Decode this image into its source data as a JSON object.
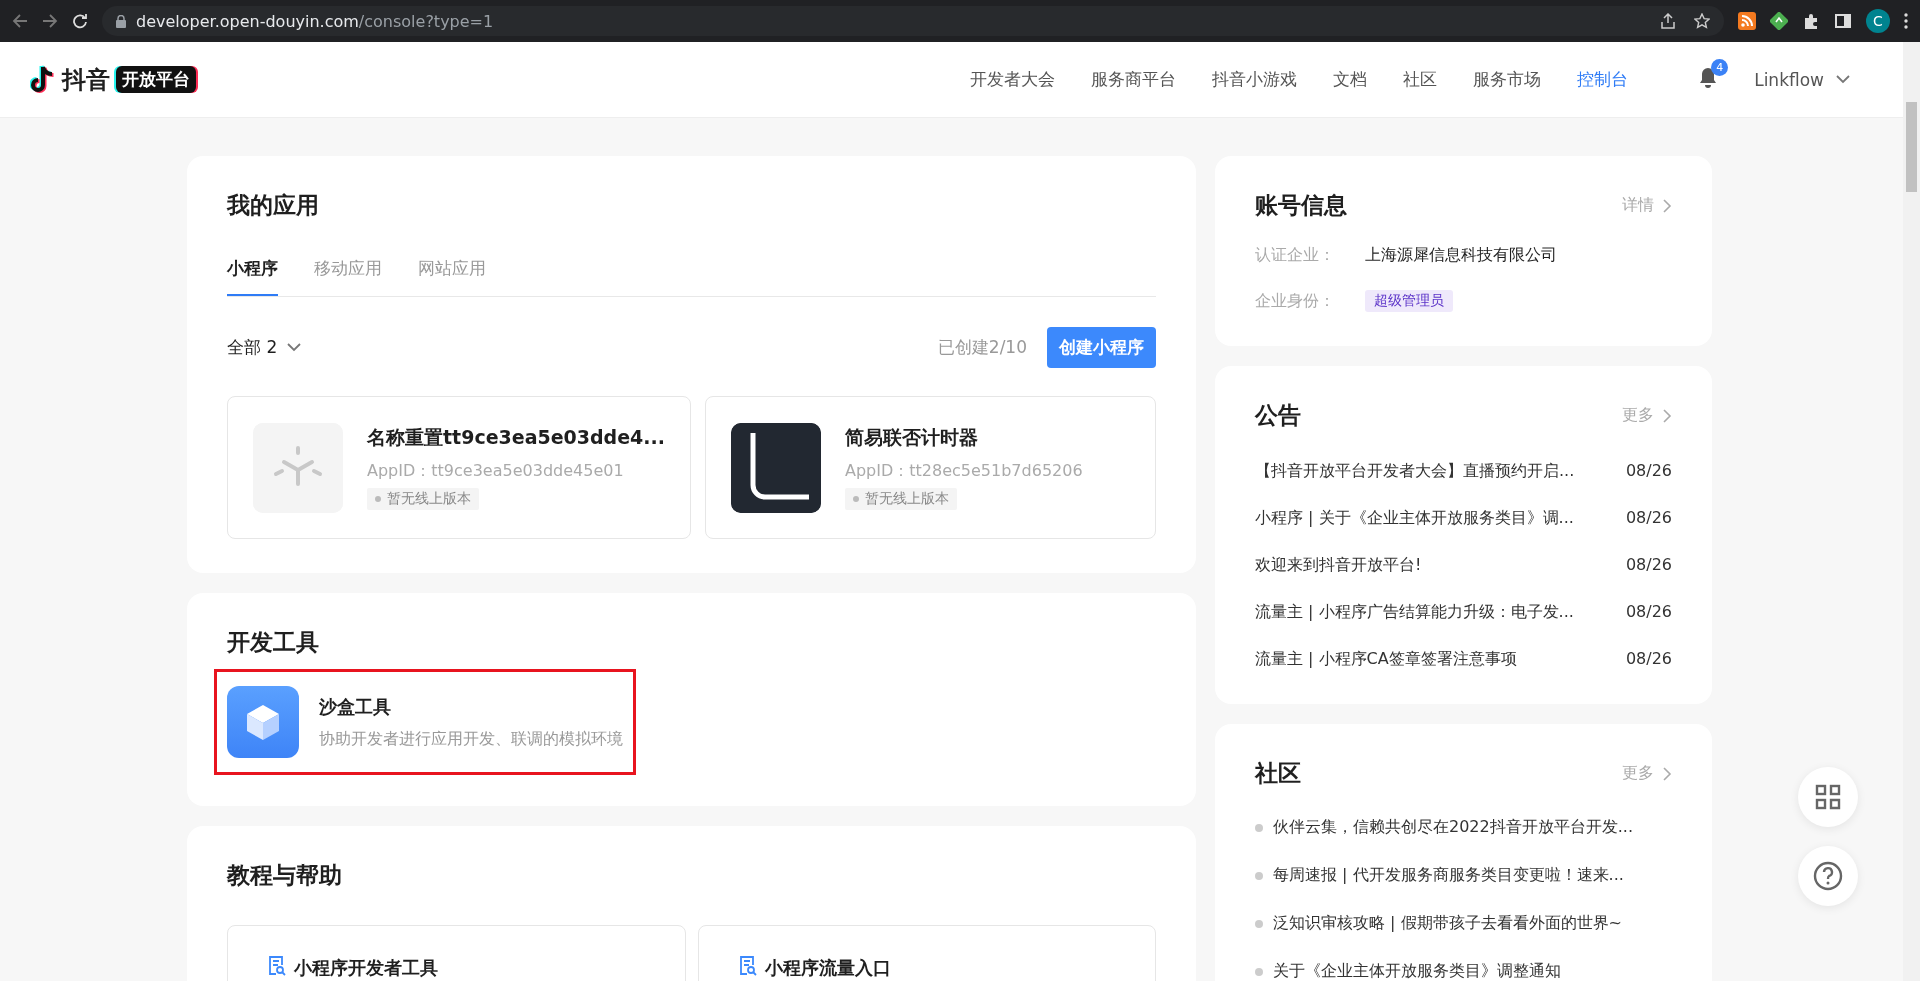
{
  "browser": {
    "url_host": "developer.open-douyin.com",
    "url_path": "/console?type=1",
    "profile_initial": "C"
  },
  "header": {
    "logo_text": "抖音",
    "logo_badge": "开放平台",
    "nav": [
      {
        "label": "开发者大会",
        "selected": false
      },
      {
        "label": "服务商平台",
        "selected": false
      },
      {
        "label": "抖音小游戏",
        "selected": false
      },
      {
        "label": "文档",
        "selected": false
      },
      {
        "label": "社区",
        "selected": false
      },
      {
        "label": "服务市场",
        "selected": false
      },
      {
        "label": "控制台",
        "selected": true
      }
    ],
    "notification_count": "4",
    "user": "Linkflow"
  },
  "my_apps": {
    "title": "我的应用",
    "tabs": [
      {
        "label": "小程序",
        "selected": true
      },
      {
        "label": "移动应用",
        "selected": false
      },
      {
        "label": "网站应用",
        "selected": false
      }
    ],
    "filter": "全部 2",
    "created": "已创建2/10",
    "create_button": "创建小程序",
    "apps": [
      {
        "kind": "placeholder",
        "name": "名称重置tt9ce3ea5e03dde4...",
        "appid": "AppID：tt9ce3ea5e03dde45e01",
        "status": "暂无线上版本"
      },
      {
        "kind": "letter",
        "name": "简易联否计时器",
        "appid": "AppID：tt28ec5e51b7d65206",
        "status": "暂无线上版本"
      }
    ]
  },
  "dev_tools": {
    "title": "开发工具",
    "tools": [
      {
        "name": "沙盒工具",
        "description": "协助开发者进行应用开发、联调的模拟环境",
        "highlighted": true
      }
    ]
  },
  "tutorials": {
    "title": "教程与帮助",
    "items": [
      "小程序开发者工具",
      "小程序流量入口"
    ]
  },
  "account": {
    "title": "账号信息",
    "link": "详情",
    "fields": [
      {
        "label": "认证企业：",
        "kind": "text",
        "value": "上海源犀信息科技有限公司"
      },
      {
        "label": "企业身份：",
        "kind": "tag",
        "value": "超级管理员"
      }
    ]
  },
  "announcements": {
    "title": "公告",
    "link": "更多",
    "items": [
      {
        "text": "【抖音开放平台开发者大会】直播预约开启...",
        "date": "08/26"
      },
      {
        "text": "小程序 | 关于《企业主体开放服务类目》调...",
        "date": "08/26"
      },
      {
        "text": "欢迎来到抖音开放平台!",
        "date": "08/26"
      },
      {
        "text": "流量主 | 小程序广告结算能力升级：电子发...",
        "date": "08/26"
      },
      {
        "text": "流量主 | 小程序CA签章签署注意事项",
        "date": "08/26"
      }
    ]
  },
  "community": {
    "title": "社区",
    "link": "更多",
    "items": [
      "伙伴云集，信赖共创尽在2022抖音开放平台开发...",
      "每周速报 | 代开发服务商服务类目变更啦！速来...",
      "泛知识审核攻略 | 假期带孩子去看看外面的世界~",
      "关于《企业主体开放服务类目》调整通知"
    ]
  }
}
